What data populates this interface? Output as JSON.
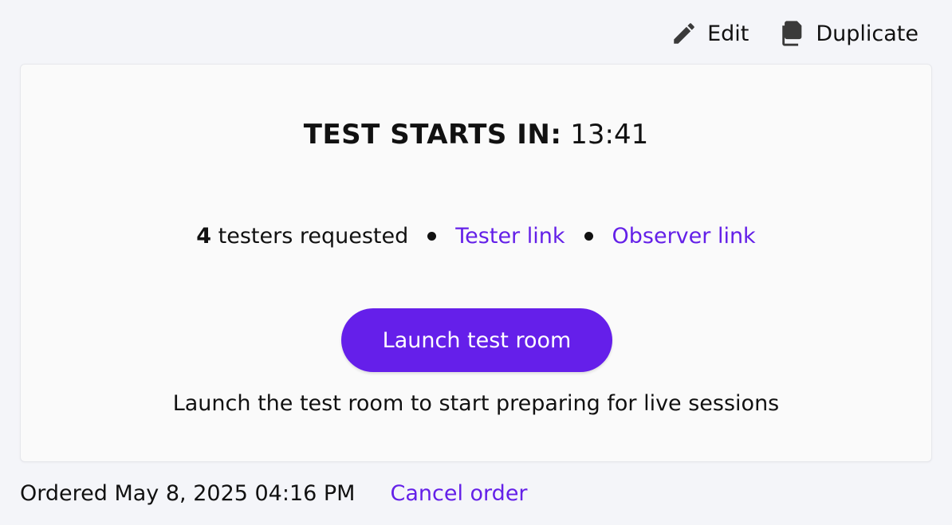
{
  "toolbar": {
    "edit_label": "Edit",
    "duplicate_label": "Duplicate"
  },
  "card": {
    "countdown_label": "TEST STARTS IN:",
    "countdown_time": "13:41",
    "testers_count": "4",
    "testers_text": "testers requested",
    "tester_link": "Tester link",
    "observer_link": "Observer link",
    "launch_button": "Launch test room",
    "helper_text": "Launch the test room to start preparing for live sessions"
  },
  "footer": {
    "ordered_text": "Ordered May 8, 2025 04:16 PM",
    "cancel_link": "Cancel order"
  },
  "colors": {
    "accent": "#651fea",
    "link": "#6420e8",
    "background": "#f4f5f9",
    "card": "#fafafa"
  },
  "icons": {
    "edit": "pencil-icon",
    "duplicate": "copy-icon"
  }
}
